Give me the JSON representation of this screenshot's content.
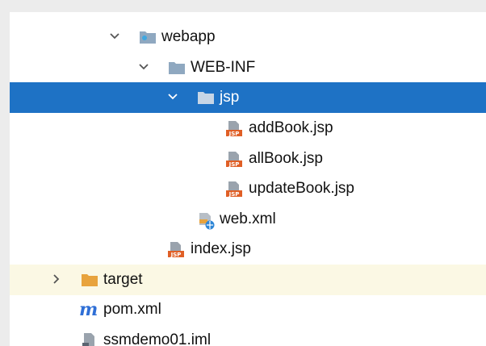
{
  "project_tree": {
    "items": [
      {
        "label": "webapp",
        "icon": "web-folder-icon",
        "arrow": "expanded"
      },
      {
        "label": "WEB-INF",
        "icon": "folder-icon",
        "arrow": "expanded"
      },
      {
        "label": "jsp",
        "icon": "folder-icon",
        "arrow": "expanded",
        "selected": true
      },
      {
        "label": "addBook.jsp",
        "icon": "jsp-file-icon"
      },
      {
        "label": "allBook.jsp",
        "icon": "jsp-file-icon"
      },
      {
        "label": "updateBook.jsp",
        "icon": "jsp-file-icon"
      },
      {
        "label": "web.xml",
        "icon": "web-xml-icon"
      },
      {
        "label": "index.jsp",
        "icon": "jsp-file-icon"
      },
      {
        "label": "target",
        "icon": "excluded-folder-icon",
        "arrow": "collapsed"
      },
      {
        "label": "pom.xml",
        "icon": "maven-icon"
      },
      {
        "label": "ssmdemo01.iml",
        "icon": "iml-file-icon"
      }
    ]
  },
  "colors": {
    "selection": "#1e72c5",
    "excluded_row": "#fbf8e4",
    "folder": "#8fa8c0",
    "excluded_folder": "#e8a33d",
    "jsp_badge": "#e05f26",
    "maven": "#2f6fd6"
  }
}
